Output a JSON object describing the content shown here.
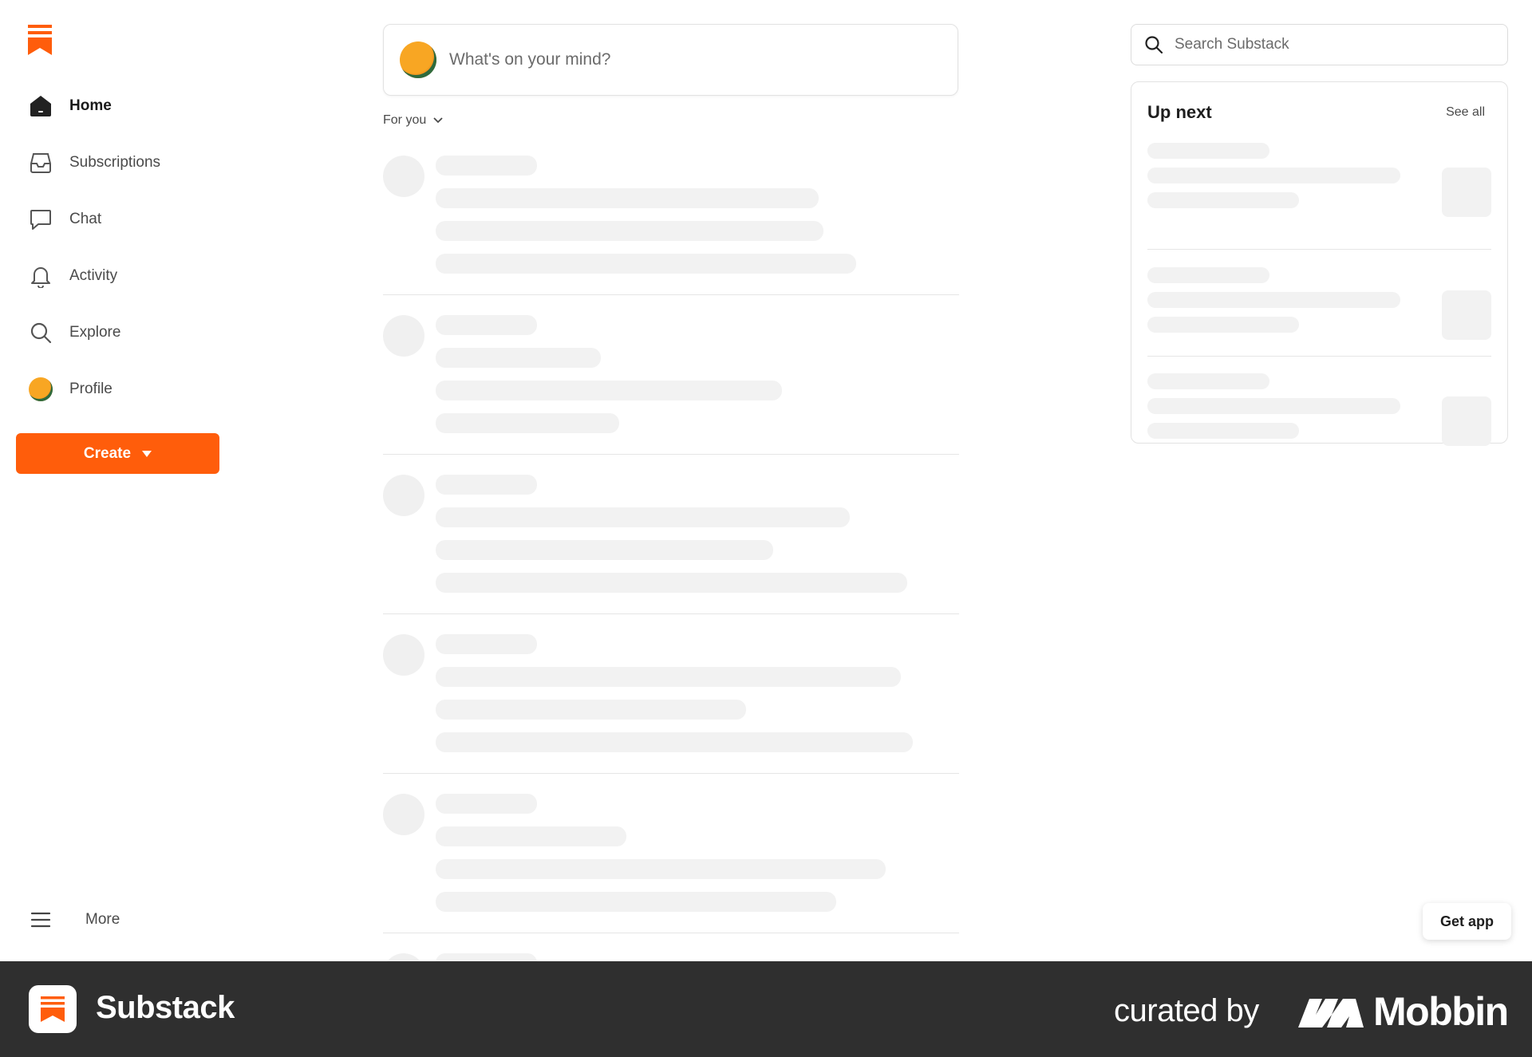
{
  "sidebar": {
    "items": [
      {
        "label": "Home",
        "icon": "home-icon",
        "active": true
      },
      {
        "label": "Subscriptions",
        "icon": "inbox-icon"
      },
      {
        "label": "Chat",
        "icon": "chat-bubble-icon"
      },
      {
        "label": "Activity",
        "icon": "bell-icon"
      },
      {
        "label": "Explore",
        "icon": "search-icon"
      },
      {
        "label": "Profile",
        "icon": "avatar"
      }
    ],
    "create_label": "Create",
    "more_label": "More"
  },
  "composer": {
    "placeholder": "What's on your mind?"
  },
  "feed": {
    "filter_label": "For you"
  },
  "search": {
    "placeholder": "Search Substack"
  },
  "up_next": {
    "title": "Up next",
    "see_all_label": "See all"
  },
  "get_app_label": "Get app",
  "footer": {
    "app_name": "Substack",
    "curated_label": "curated by",
    "brand": "Mobbin"
  },
  "colors": {
    "accent": "#ff5d0b",
    "footer_bg": "#2f2f2f",
    "skeleton": "#f2f2f2"
  }
}
